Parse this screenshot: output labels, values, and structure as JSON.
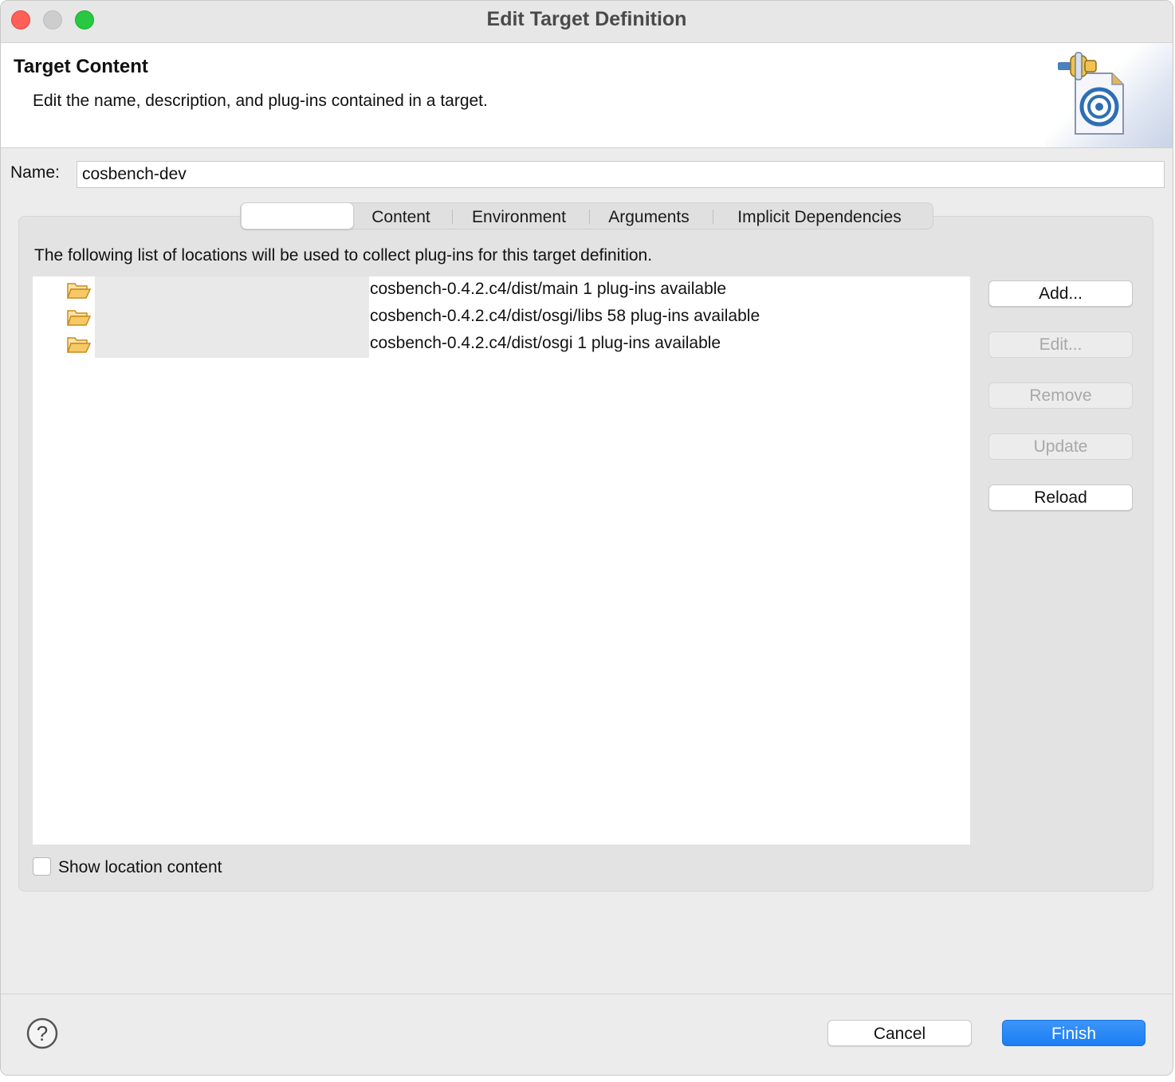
{
  "window": {
    "title": "Edit Target Definition"
  },
  "banner": {
    "title": "Target Content",
    "description": "Edit the name, description, and plug-ins contained in a target.",
    "icon": "target-definition-icon"
  },
  "name_field": {
    "label": "Name:",
    "value": "cosbench-dev"
  },
  "tabs": [
    {
      "label": "",
      "selected": true
    },
    {
      "label": "Content",
      "selected": false
    },
    {
      "label": "Environment",
      "selected": false
    },
    {
      "label": "Arguments",
      "selected": false
    },
    {
      "label": "Implicit Dependencies",
      "selected": false
    }
  ],
  "locations_panel": {
    "description": "The following list of locations will be used to collect plug-ins for this target definition.",
    "items": [
      {
        "icon": "folder-open-icon",
        "path": "cosbench-0.4.2.c4/dist/main 1 plug-ins available"
      },
      {
        "icon": "folder-open-icon",
        "path": "cosbench-0.4.2.c4/dist/osgi/libs 58 plug-ins available"
      },
      {
        "icon": "folder-open-icon",
        "path": "cosbench-0.4.2.c4/dist/osgi 1 plug-ins available"
      }
    ],
    "show_location_content": {
      "label": "Show location content",
      "checked": false
    }
  },
  "side_buttons": {
    "add": "Add...",
    "edit": "Edit...",
    "remove": "Remove",
    "update": "Update",
    "reload": "Reload"
  },
  "footer": {
    "help_icon": "help-icon",
    "cancel": "Cancel",
    "finish": "Finish"
  },
  "colors": {
    "finish_button": "#1a7ef4",
    "close_light": "#fe5f57",
    "minimize_light": "#cdcdcd",
    "maximize_light": "#28c840",
    "folder": "#e8a43a"
  }
}
